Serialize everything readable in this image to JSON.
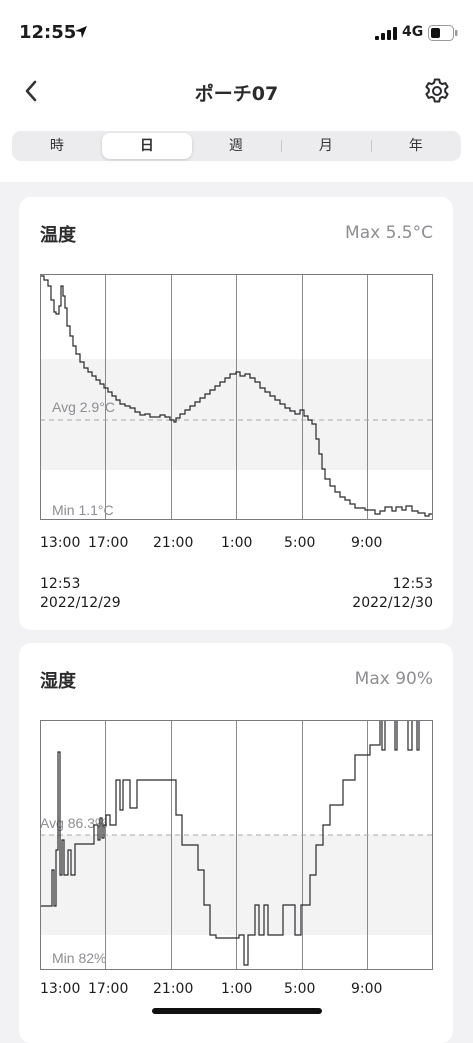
{
  "status": {
    "time": "12:55",
    "network": "4G"
  },
  "nav": {
    "title": "ポーチ07"
  },
  "tabs": [
    "時",
    "日",
    "週",
    "月",
    "年"
  ],
  "active_tab": "日",
  "temperature": {
    "title": "温度",
    "max": "Max 5.5°C",
    "avg": "Avg 2.9°C",
    "min": "Min 1.1°C",
    "x_ticks": [
      "13:00",
      "17:00",
      "21:00",
      "1:00",
      "5:00",
      "9:00"
    ],
    "start_time": "12:53",
    "start_date": "2022/12/29",
    "end_time": "12:53",
    "end_date": "2022/12/30"
  },
  "humidity": {
    "title": "湿度",
    "max": "Max 90%",
    "avg": "Avg 86.3%",
    "min": "Min 82%",
    "x_ticks": [
      "13:00",
      "17:00",
      "21:00",
      "1:00",
      "5:00",
      "9:00"
    ]
  },
  "chart_data": [
    {
      "type": "line",
      "title": "温度",
      "x": [
        "12:53",
        "13:30",
        "14:00",
        "14:30",
        "15:00",
        "16:00",
        "17:00",
        "18:00",
        "19:00",
        "20:00",
        "21:00",
        "22:00",
        "23:00",
        "0:00",
        "1:00",
        "2:00",
        "3:00",
        "4:00",
        "5:00",
        "6:00",
        "7:00",
        "8:00",
        "9:00",
        "10:00",
        "11:00",
        "12:00",
        "12:53"
      ],
      "series": [
        {
          "values": [
            5.5,
            5.0,
            4.3,
            3.9,
            3.6,
            3.4,
            3.3,
            3.1,
            2.9,
            2.9,
            2.8,
            3.1,
            3.4,
            3.7,
            3.8,
            3.7,
            3.4,
            3.2,
            2.9,
            2.1,
            1.4,
            1.2,
            1.1,
            1.15,
            1.2,
            1.15,
            1.1
          ]
        }
      ],
      "ylim": [
        1.1,
        5.5
      ],
      "avg": 2.9
    },
    {
      "type": "line",
      "title": "湿度",
      "x": [
        "12:53",
        "13:30",
        "14:00",
        "15:00",
        "16:00",
        "17:00",
        "18:00",
        "19:00",
        "20:00",
        "21:00",
        "22:00",
        "23:00",
        "0:00",
        "1:00",
        "2:00",
        "3:00",
        "4:00",
        "5:00",
        "6:00",
        "7:00",
        "8:00",
        "9:00",
        "10:00",
        "11:00",
        "12:00"
      ],
      "series": [
        {
          "values": [
            84,
            85,
            86,
            86.5,
            86.5,
            87,
            88,
            88,
            88,
            87,
            86,
            84,
            83,
            83,
            82.5,
            83,
            83,
            83,
            84,
            86,
            87.5,
            88.5,
            89.5,
            90,
            90
          ]
        }
      ],
      "ylim": [
        82,
        90
      ],
      "avg": 86.3
    }
  ]
}
